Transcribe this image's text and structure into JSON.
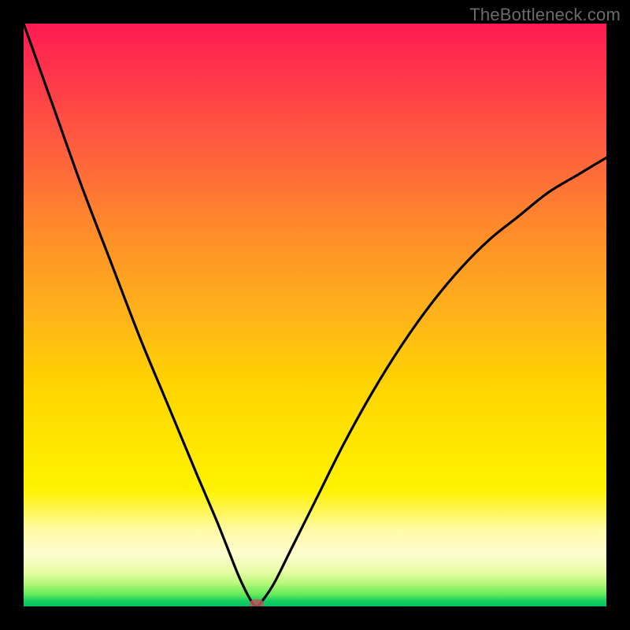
{
  "watermark": "TheBottleneck.com",
  "chart_data": {
    "type": "line",
    "title": "",
    "xlabel": "",
    "ylabel": "",
    "xlim": [
      0,
      100
    ],
    "ylim": [
      0,
      100
    ],
    "grid": false,
    "legend": false,
    "annotations": [],
    "background_gradient_stops": [
      {
        "pos": 0,
        "color": "#ff1a52"
      },
      {
        "pos": 25,
        "color": "#ff6a3a"
      },
      {
        "pos": 50,
        "color": "#ffb31a"
      },
      {
        "pos": 72,
        "color": "#ffe600"
      },
      {
        "pos": 91,
        "color": "#fdfccf"
      },
      {
        "pos": 100,
        "color": "#00c060"
      }
    ],
    "series": [
      {
        "name": "bottleneck-curve",
        "color": "#000000",
        "x": [
          0,
          5,
          10,
          15,
          20,
          25,
          30,
          33,
          35,
          37,
          39,
          40,
          41,
          43,
          46,
          50,
          55,
          60,
          65,
          70,
          75,
          80,
          85,
          90,
          95,
          100
        ],
        "y": [
          100,
          86,
          72,
          59,
          46,
          34,
          22,
          15,
          10,
          5,
          1,
          0,
          1,
          4,
          10,
          18,
          28,
          37,
          45,
          52,
          58,
          63,
          67,
          71,
          74,
          77
        ]
      }
    ],
    "marker": {
      "x": 40,
      "y": 0,
      "color": "#b85a5a"
    },
    "min_point": {
      "x": 40,
      "y": 0
    }
  }
}
